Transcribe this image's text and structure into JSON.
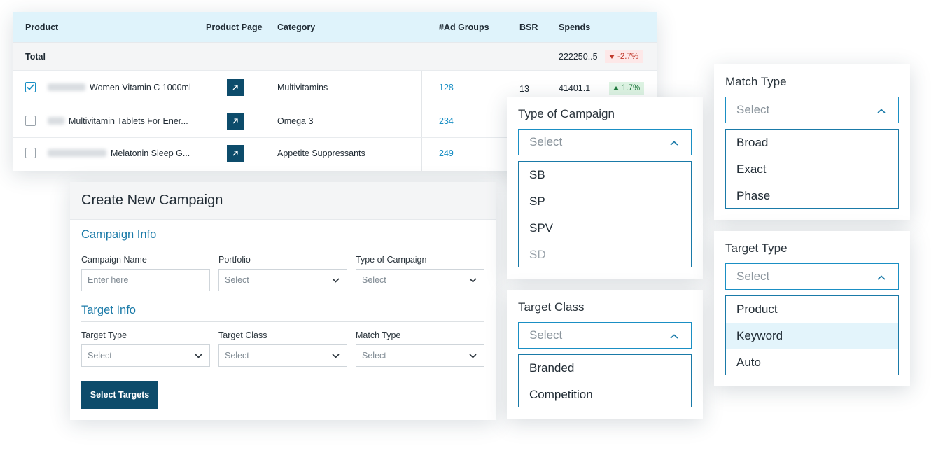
{
  "table": {
    "headers": {
      "product": "Product",
      "product_page": "Product Page",
      "category": "Category",
      "ad_groups": "#Ad Groups",
      "bsr": "BSR",
      "spends": "Spends"
    },
    "total": {
      "label": "Total",
      "spends": "222250..5",
      "change": "-2.7%",
      "change_dir": "down"
    },
    "rows": [
      {
        "checked": true,
        "name": "Women Vitamin C 1000ml",
        "category": "Multivitamins",
        "ad_groups": "128",
        "bsr": "13",
        "spends": "41401.1",
        "change": "1.7%"
      },
      {
        "checked": false,
        "name": "Multivitamin Tablets For Ener...",
        "category": "Omega 3",
        "ad_groups": "234",
        "bsr": "",
        "spends": "",
        "change": ""
      },
      {
        "checked": false,
        "name": "Melatonin Sleep G...",
        "category": "Appetite Suppressants",
        "ad_groups": "249",
        "bsr": "",
        "spends": "",
        "change": ""
      }
    ]
  },
  "form": {
    "title": "Create New Campaign",
    "campaign_info": "Campaign Info",
    "target_info": "Target Info",
    "campaign_name_label": "Campaign Name",
    "campaign_name_placeholder": "Enter here",
    "portfolio_label": "Portfolio",
    "portfolio_value": "Select",
    "type_of_campaign_label": "Type of Campaign",
    "type_of_campaign_value": "Select",
    "target_type_label": "Target Type",
    "target_type_value": "Select",
    "target_class_label": "Target Class",
    "target_class_value": "Select",
    "match_type_label": "Match Type",
    "match_type_value": "Select",
    "submit_label": "Select Targets"
  },
  "dropdowns": {
    "type_of_campaign": {
      "title": "Type of Campaign",
      "value": "Select",
      "options": [
        "SB",
        "SP",
        "SPV",
        "SD"
      ]
    },
    "target_class": {
      "title": "Target Class",
      "value": "Select",
      "options": [
        "Branded",
        "Competition"
      ]
    },
    "match_type": {
      "title": "Match Type",
      "value": "Select",
      "options": [
        "Broad",
        "Exact",
        "Phase"
      ]
    },
    "target_type": {
      "title": "Target Type",
      "value": "Select",
      "options": [
        "Product",
        "Keyword",
        "Auto"
      ],
      "highlighted": "Keyword"
    }
  },
  "colors": {
    "accent": "#1a8fc4",
    "primary_button": "#0d4c6b",
    "header_bg": "#dff3fb",
    "negative": "#c0392b",
    "positive": "#1f7a3d"
  }
}
